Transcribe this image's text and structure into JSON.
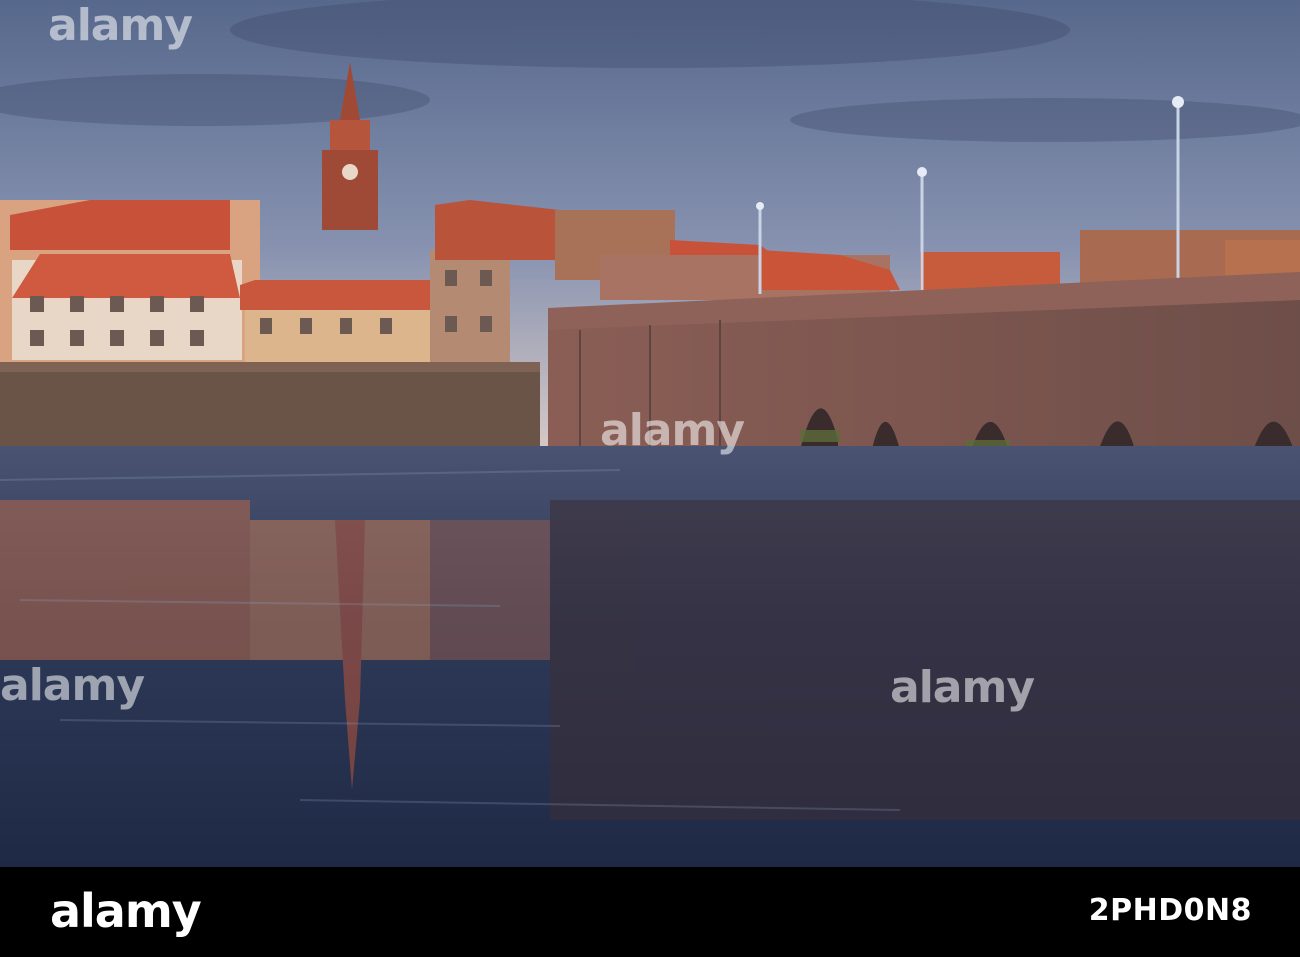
{
  "photo": {
    "subject": "riverside-town-with-stone-arch-bridge-at-sunset"
  },
  "watermark": {
    "text": "alamy"
  },
  "footer": {
    "logo_text": "alamy",
    "image_id": "2PHD0N8"
  },
  "colors": {
    "sky_top": "#5d6f93",
    "sky_bottom": "#c9c3c7",
    "roof_red": "#c8513a",
    "stone": "#7d5a52",
    "water": "#2e3a55"
  }
}
